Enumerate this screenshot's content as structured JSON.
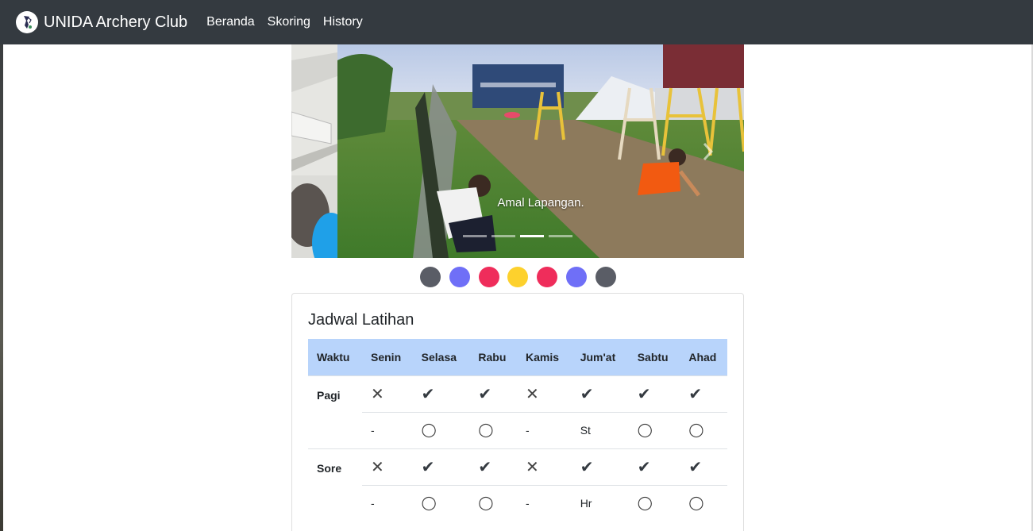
{
  "navbar": {
    "brand": "UNIDA Archery Club",
    "links": [
      "Beranda",
      "Skoring",
      "History"
    ]
  },
  "carousel": {
    "caption": "Amal Lapangan.",
    "slide_count": 4,
    "active_index": 2
  },
  "color_dots": [
    "#5a5d66",
    "#6f6ff7",
    "#ef2d5b",
    "#fdd12d",
    "#ef2d5b",
    "#6f6ff7",
    "#5a5d66"
  ],
  "schedule": {
    "title": "Jadwal Latihan",
    "headers": [
      "Waktu",
      "Senin",
      "Selasa",
      "Rabu",
      "Kamis",
      "Jum'at",
      "Sabtu",
      "Ahad"
    ],
    "rows": [
      {
        "waktu": "Pagi",
        "top": [
          "✕",
          "✔",
          "✔",
          "✕",
          "✔",
          "✔",
          "✔"
        ],
        "bottom": [
          "-",
          "◯",
          "◯",
          "-",
          "St",
          "◯",
          "◯"
        ]
      },
      {
        "waktu": "Sore",
        "top": [
          "✕",
          "✔",
          "✔",
          "✕",
          "✔",
          "✔",
          "✔"
        ],
        "bottom": [
          "-",
          "◯",
          "◯",
          "-",
          "Hr",
          "◯",
          "◯"
        ]
      }
    ]
  }
}
